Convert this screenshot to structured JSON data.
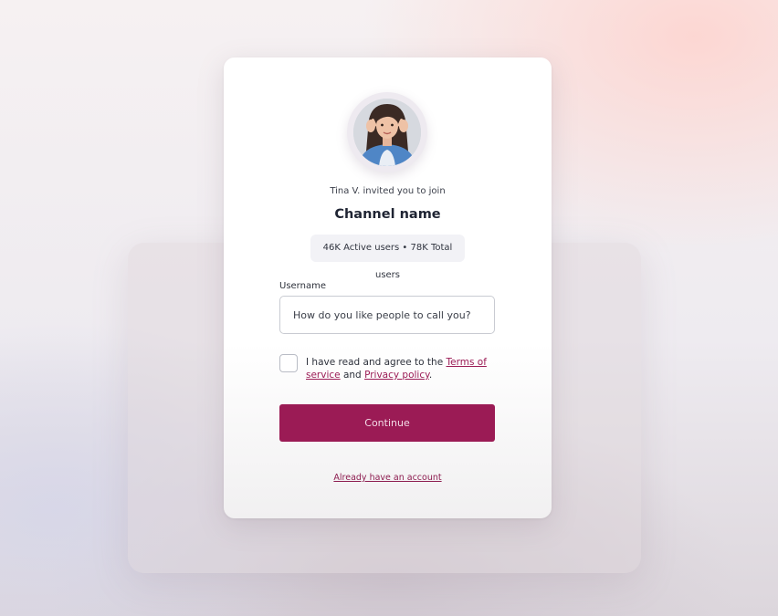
{
  "invite": {
    "text": "Tina V. invited you to join",
    "avatar_icon": "user-avatar-photo"
  },
  "channel": {
    "name": "Channel name",
    "stats": "46K Active users • 78K Total users"
  },
  "form": {
    "username_label": "Username",
    "username_placeholder": "How do you like people to call you?",
    "username_value": "",
    "agree_checked": false,
    "agree_prefix": "I have read and agree to the ",
    "terms_link": "Terms of service",
    "agree_middle": " and ",
    "privacy_link": "Privacy policy",
    "agree_suffix": "."
  },
  "actions": {
    "continue_label": "Continue",
    "account_link": "Already have an account"
  },
  "colors": {
    "accent": "#9b1b55",
    "card_background": "#ffffff",
    "text_primary": "#1f2433"
  }
}
